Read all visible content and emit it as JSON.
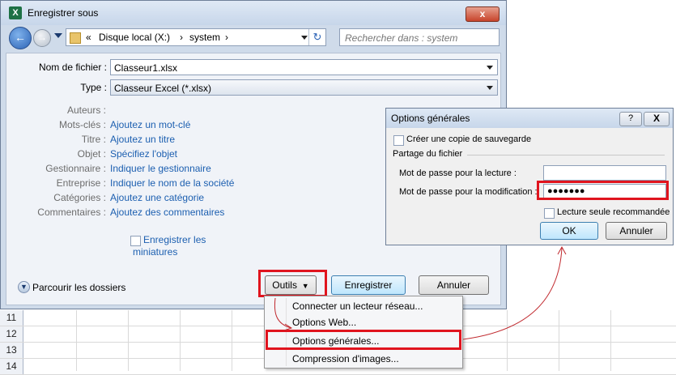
{
  "window": {
    "title": "Enregistrer sous",
    "close_label": "x"
  },
  "nav": {
    "path": [
      "«",
      "Disque local (X:)",
      "›",
      "system",
      "›"
    ],
    "search_placeholder": "Rechercher dans : system"
  },
  "form": {
    "filename_label": "Nom de fichier :",
    "filename_value": "Classeur1.xlsx",
    "type_label": "Type :",
    "type_value": "Classeur Excel (*.xlsx)"
  },
  "metadata": [
    {
      "label": "Auteurs :",
      "value": ""
    },
    {
      "label": "Mots-clés :",
      "value": "Ajoutez un mot-clé"
    },
    {
      "label": "Titre :",
      "value": "Ajoutez un titre"
    },
    {
      "label": "Objet :",
      "value": "Spécifiez l'objet"
    },
    {
      "label": "Gestionnaire :",
      "value": "Indiquer le gestionnaire"
    },
    {
      "label": "Entreprise :",
      "value": "Indiquer le nom de la société"
    },
    {
      "label": "Catégories :",
      "value": "Ajoutez une catégorie"
    },
    {
      "label": "Commentaires :",
      "value": "Ajoutez des commentaires"
    }
  ],
  "thumbnails": {
    "line1": "Enregistrer les",
    "line2": "miniatures",
    "checked": false
  },
  "footer": {
    "browse_label": "Parcourir les dossiers",
    "tools_label": "Outils",
    "save_label": "Enregistrer",
    "cancel_label": "Annuler"
  },
  "tools_menu": [
    "Connecter un lecteur réseau...",
    "Options Web...",
    "Options générales...",
    "Compression d'images..."
  ],
  "options_dialog": {
    "title": "Options générales",
    "help_label": "?",
    "close_label": "X",
    "backup_label": "Créer une copie de sauvegarde",
    "backup_checked": false,
    "section_label": "Partage du fichier",
    "read_pw_label": "Mot de passe pour la lecture :",
    "read_pw_value": "",
    "modify_pw_label": "Mot de passe pour la modification :",
    "modify_pw_value": "●●●●●●●",
    "readonly_label": "Lecture seule recommandée",
    "readonly_checked": false,
    "ok_label": "OK",
    "cancel_label": "Annuler"
  },
  "sheet": {
    "rows": [
      "11",
      "12",
      "13",
      "14"
    ]
  },
  "colors": {
    "highlight": "#e0141e",
    "link": "#1c5fb0",
    "arrow": "#c0282d"
  }
}
